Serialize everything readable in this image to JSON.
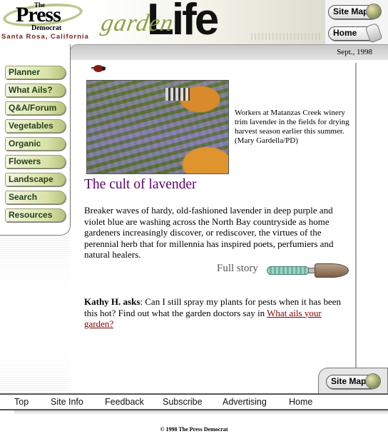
{
  "header": {
    "logo": {
      "the": "The",
      "press": "Press",
      "democrat": "Democrat",
      "city": "Santa Rosa, California"
    },
    "masthead": {
      "garden": "garden",
      "life": "Life"
    },
    "site_map_label": "Site Map",
    "home_label": "Home"
  },
  "date": "Sept., 1998",
  "sidebar": {
    "items": [
      {
        "label": "Planner"
      },
      {
        "label": "What Ails?"
      },
      {
        "label": "Q&A/Forum"
      },
      {
        "label": "Vegetables"
      },
      {
        "label": "Organic"
      },
      {
        "label": "Flowers"
      },
      {
        "label": "Landscape"
      },
      {
        "label": "Search"
      },
      {
        "label": "Resources"
      }
    ]
  },
  "article": {
    "caption": "Workers at Matanzas Creek winery trim lavender in the fields for drying harvest season earlier this summer. (Mary Gardella/PD)",
    "headline": "The cult of lavender",
    "lede": "Breaker waves of hardy, old-fashioned lavender in deep purple and violet blue are washing across the North Bay countryside as home gardeners increasingly discover, or rediscover, the virtues of the perennial herb that for millennia has inspired poets, perfumiers and natural healers.",
    "full_story_label": "Full story"
  },
  "qa": {
    "asker": "Kathy H. asks",
    "text": ": Can I still spray my plants for pests when it has been this hot? Find out what the garden doctors say in ",
    "link_label": "What ails your garden?"
  },
  "footer": {
    "site_map_label": "Site Map",
    "links": [
      {
        "label": "Top"
      },
      {
        "label": "Site Info"
      },
      {
        "label": "Feedback"
      },
      {
        "label": "Subscribe"
      },
      {
        "label": "Advertising"
      },
      {
        "label": "Home"
      }
    ],
    "copyright": "© 1998 The Press Democrat"
  },
  "colors": {
    "headline": "#5a006f",
    "nav_button": "#d9e2a8",
    "link": "#7a0000",
    "garden_script": "#8ea246"
  }
}
